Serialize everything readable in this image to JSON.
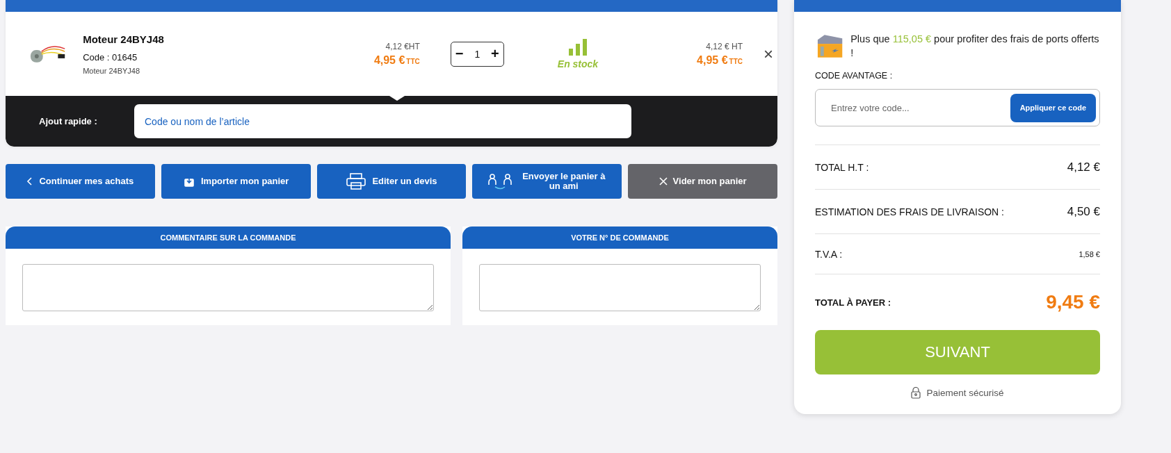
{
  "cart_item": {
    "name": "Moteur 24BYJ48",
    "code": "Code : 01645",
    "description": "Moteur 24BYJ48",
    "unit_price_ht": "4,12 €HT",
    "unit_price_ttc": "4,95 €",
    "unit_ttc_suffix": "TTC",
    "quantity": {
      "decrement": "−",
      "value": "1",
      "increment": "+"
    },
    "stock": {
      "label": "En stock",
      "in_stock": true
    },
    "total_ht": "4,12 € HT",
    "total_ttc": "4,95 €",
    "total_ttc_suffix": "TTC",
    "remove": "×"
  },
  "quick_add": {
    "label": "Ajout rapide :",
    "placeholder": "Code ou nom de l’article"
  },
  "actions": [
    {
      "kind": "back",
      "label": "Continuer mes achats"
    },
    {
      "kind": "import",
      "label": "Importer mon panier"
    },
    {
      "kind": "print",
      "label": "Editer un devis"
    },
    {
      "kind": "share",
      "label": "Envoyer le panier à un ami"
    },
    {
      "kind": "clear",
      "label": "Vider mon panier"
    }
  ],
  "comment_boxes": [
    {
      "title": "COMMENTAIRE SUR LA COMMANDE"
    },
    {
      "title": "VOTRE N° DE COMMANDE"
    }
  ],
  "summary": {
    "promo": {
      "before": "Plus que ",
      "amount": "115,05 €",
      "after": " pour profiter des frais de ports offerts !"
    },
    "coupon": {
      "label": "CODE AVANTAGE :",
      "placeholder": "Entrez votre code...",
      "button": "Appliquer ce code"
    },
    "rows": [
      {
        "kind": "normal",
        "label": "TOTAL H.T :",
        "value": "4,12 €"
      },
      {
        "kind": "normal",
        "label": "ESTIMATION DES FRAIS DE LIVRAISON :",
        "value": "4,50 €"
      },
      {
        "kind": "small",
        "label": "T.V.A :",
        "value": "1,58 €"
      },
      {
        "kind": "grand",
        "label": "TOTAL À PAYER :",
        "value": "9,45 €"
      }
    ],
    "next_button": "SUIVANT",
    "secure_note": "Paiement sécurisé"
  }
}
